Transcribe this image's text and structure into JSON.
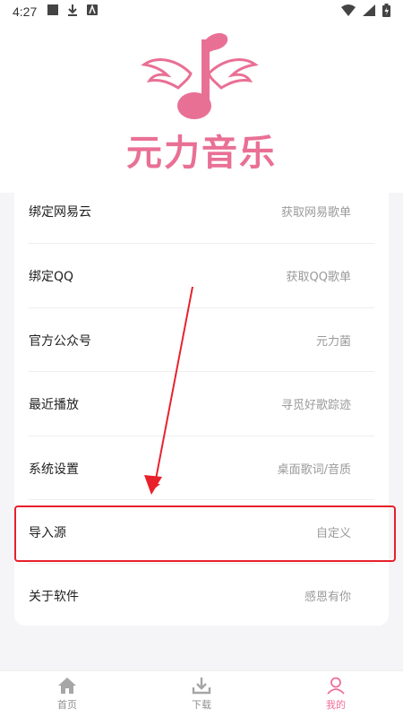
{
  "status_bar": {
    "time": "4:27"
  },
  "logo": {
    "text": "元力音乐",
    "color": "#e97095"
  },
  "menu": [
    {
      "label": "绑定网易云",
      "value": "获取网易歌单"
    },
    {
      "label": "绑定QQ",
      "value": "获取QQ歌单"
    },
    {
      "label": "官方公众号",
      "value": "元力菌"
    },
    {
      "label": "最近播放",
      "value": "寻觅好歌踪迹"
    },
    {
      "label": "系统设置",
      "value": "桌面歌词/音质"
    },
    {
      "label": "导入源",
      "value": "自定义"
    },
    {
      "label": "关于软件",
      "value": "感恩有你"
    }
  ],
  "tabs": [
    {
      "label": "首页",
      "icon": "home-icon",
      "active": false
    },
    {
      "label": "下载",
      "icon": "download-icon",
      "active": false
    },
    {
      "label": "我的",
      "icon": "user-icon",
      "active": true
    }
  ],
  "colors": {
    "accent": "#f06d97",
    "highlight": "#e8202a"
  }
}
